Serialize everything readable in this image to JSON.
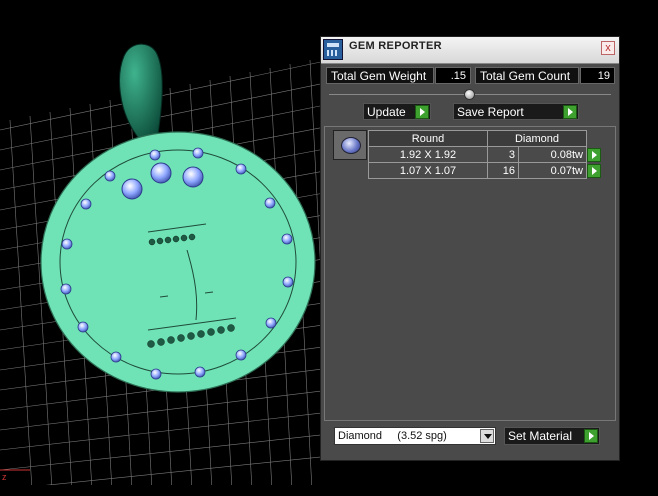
{
  "window": {
    "title": "GEM REPORTER",
    "close_glyph": "x"
  },
  "stats": {
    "weight_label": "Total Gem Weight",
    "weight_value": ".15",
    "count_label": "Total Gem Count",
    "count_value": "19"
  },
  "actions": {
    "update_label": "Update",
    "save_label": "Save Report"
  },
  "gem_table": {
    "shape_header": "Round",
    "material_header": "Diamond",
    "rows": [
      {
        "size": "1.92 X 1.92",
        "count": "3",
        "weight": "0.08tw"
      },
      {
        "size": "1.07 X 1.07",
        "count": "16",
        "weight": "0.07tw"
      }
    ]
  },
  "material": {
    "selected": "Diamond     (3.52 spg)",
    "set_label": "Set Material"
  },
  "icons": {
    "app": "gem-reporter-icon",
    "gem": "round-diamond-icon",
    "play": "green-arrow-icon"
  },
  "colors": {
    "pendant": "#6fe3b6",
    "bail": "#116b52",
    "accent_green": "#3ea02e"
  }
}
